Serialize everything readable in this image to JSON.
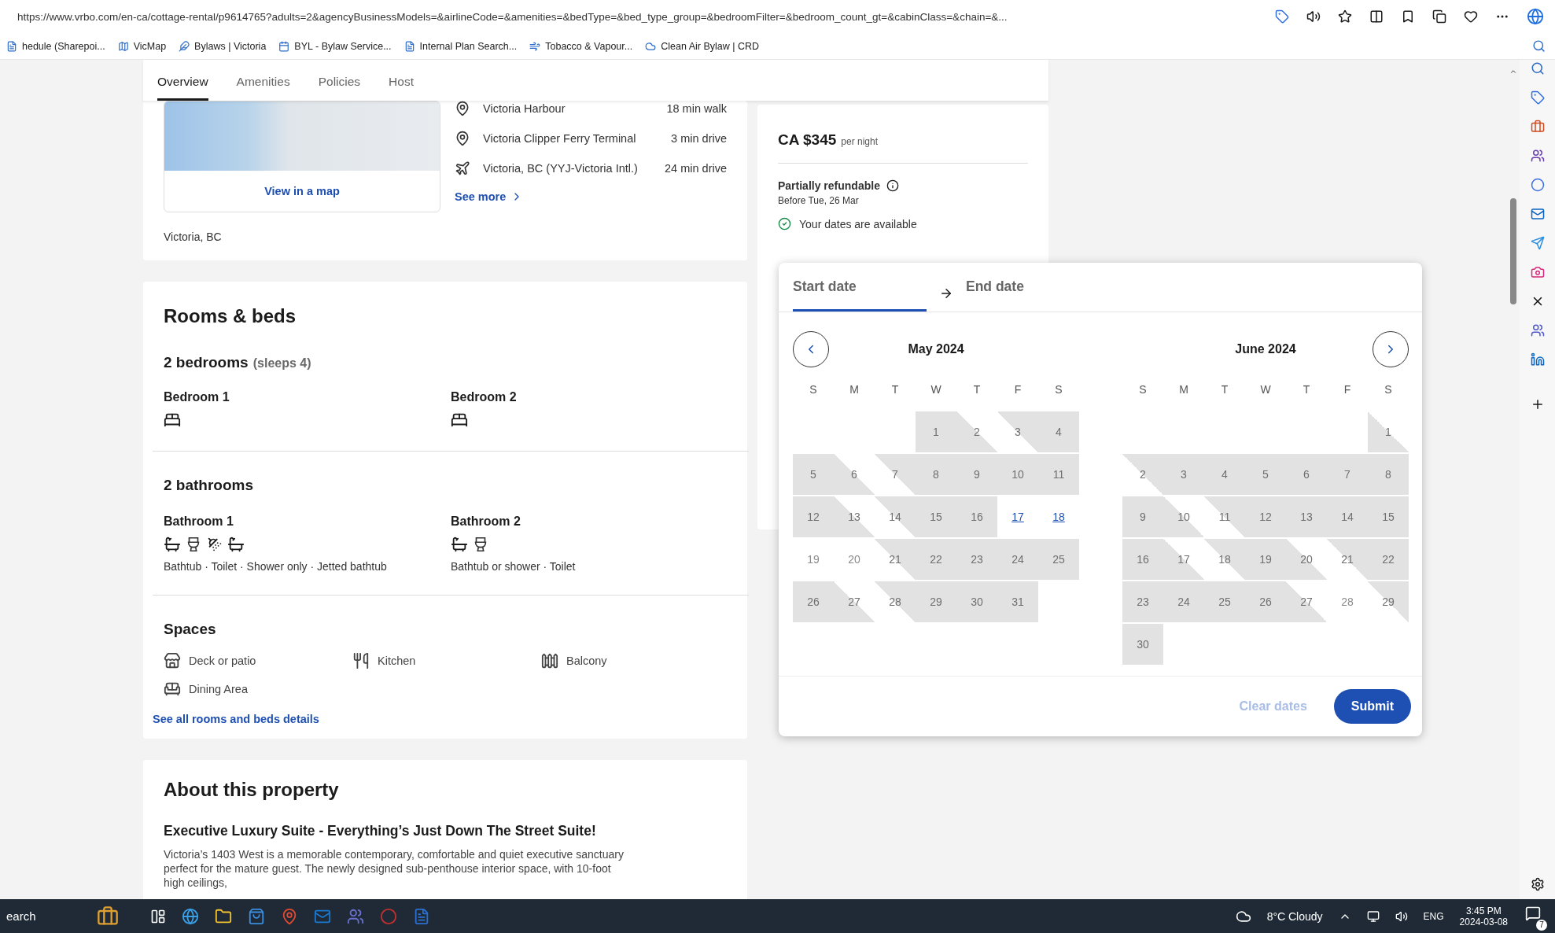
{
  "browser": {
    "url": "https://www.vrbo.com/en-ca/cottage-rental/p9614765?adults=2&agencyBusinessModels=&airlineCode=&amenities=&bedType=&bed_type_group=&bedroomFilter=&bedroom_count_gt=&cabinClass=&chain=&...",
    "bookmarks": [
      "hedule (Sharepoi...",
      "VicMap",
      "Bylaws | Victoria",
      "BYL - Bylaw Service...",
      "Internal Plan Search...",
      "Tobacco & Vapour...",
      "Clean Air Bylaw | CRD"
    ]
  },
  "tabs": [
    {
      "label": "Overview",
      "selected": true
    },
    {
      "label": "Amenities",
      "selected": false
    },
    {
      "label": "Policies",
      "selected": false
    },
    {
      "label": "Host",
      "selected": false
    }
  ],
  "location": {
    "map_link": "View in a map",
    "address": "Victoria, BC",
    "see_more": "See more",
    "places": [
      {
        "kind": "pin",
        "name": "Victoria Harbour",
        "distance": "18 min walk"
      },
      {
        "kind": "pin",
        "name": "Victoria Clipper Ferry Terminal",
        "distance": "3 min drive"
      },
      {
        "kind": "plane",
        "name": "Victoria, BC (YYJ-Victoria Intl.)",
        "distance": "24 min drive"
      }
    ]
  },
  "rooms": {
    "title": "Rooms & beds",
    "bedrooms": "2 bedrooms",
    "sleeps": "(sleeps 4)",
    "bedroom_list": [
      {
        "name": "Bedroom 1"
      },
      {
        "name": "Bedroom 2"
      }
    ],
    "bathrooms": "2 bathrooms",
    "bathroom_list": [
      {
        "name": "Bathroom 1",
        "fixtures": [
          {
            "kind": "bathtub"
          },
          {
            "kind": "toilet"
          },
          {
            "kind": "shower"
          },
          {
            "kind": "bathtub"
          }
        ],
        "summary": "Bathtub · Toilet · Shower only · Jetted bathtub"
      },
      {
        "name": "Bathroom 2",
        "fixtures": [
          {
            "kind": "bathtub"
          },
          {
            "kind": "toilet"
          }
        ],
        "summary": "Bathtub or shower · Toilet"
      }
    ],
    "spaces_title": "Spaces",
    "spaces": [
      {
        "kind": "deck",
        "label": "Deck or patio"
      },
      {
        "kind": "kitchen",
        "label": "Kitchen"
      },
      {
        "kind": "balcony",
        "label": "Balcony"
      },
      {
        "kind": "dining",
        "label": "Dining Area"
      }
    ],
    "details_link": "See all rooms and beds details"
  },
  "about": {
    "title": "About this property",
    "subtitle": "Executive Luxury Suite - Everything’s Just Down The Street Suite!",
    "description": "Victoria’s 1403 West is a memorable contemporary, comfortable and quiet executive sanctuary perfect for the mature guest. The newly designed sub-penthouse interior space, with 10-foot high ceilings,"
  },
  "booking": {
    "price": "CA $345",
    "per": "per night",
    "refund": "Partially refundable",
    "refund_date": "Before Tue, 26 Mar",
    "available": "Your dates are available"
  },
  "calendar": {
    "fields": [
      {
        "label": "Start date",
        "selected": true
      },
      {
        "label": "End date",
        "selected": false
      }
    ],
    "months": [
      {
        "title": "May 2024",
        "weekdays": [
          "S",
          "M",
          "T",
          "W",
          "T",
          "F",
          "S"
        ],
        "weeks": [
          [
            {
              "kind": "blank"
            },
            {
              "kind": "blank"
            },
            {
              "kind": "blank"
            },
            {
              "day": "1",
              "kind": "blocked"
            },
            {
              "day": "2",
              "kind": "checkout"
            },
            {
              "day": "3",
              "kind": "checkin"
            },
            {
              "day": "4",
              "kind": "blocked"
            }
          ],
          [
            {
              "day": "5",
              "kind": "blocked"
            },
            {
              "day": "6",
              "kind": "checkout"
            },
            {
              "day": "7",
              "kind": "checkin"
            },
            {
              "day": "8",
              "kind": "blocked"
            },
            {
              "day": "9",
              "kind": "blocked"
            },
            {
              "day": "10",
              "kind": "blocked"
            },
            {
              "day": "11",
              "kind": "blocked"
            }
          ],
          [
            {
              "day": "12",
              "kind": "blocked"
            },
            {
              "day": "13",
              "kind": "checkout"
            },
            {
              "day": "14",
              "kind": "checkin"
            },
            {
              "day": "15",
              "kind": "blocked"
            },
            {
              "day": "16",
              "kind": "blocked"
            },
            {
              "day": "17",
              "kind": "selectable"
            },
            {
              "day": "18",
              "kind": "selectable"
            }
          ],
          [
            {
              "day": "19",
              "kind": "open"
            },
            {
              "day": "20",
              "kind": "open"
            },
            {
              "day": "21",
              "kind": "checkin"
            },
            {
              "day": "22",
              "kind": "blocked"
            },
            {
              "day": "23",
              "kind": "blocked"
            },
            {
              "day": "24",
              "kind": "blocked"
            },
            {
              "day": "25",
              "kind": "blocked"
            }
          ],
          [
            {
              "day": "26",
              "kind": "blocked"
            },
            {
              "day": "27",
              "kind": "checkout"
            },
            {
              "day": "28",
              "kind": "checkin"
            },
            {
              "day": "29",
              "kind": "blocked"
            },
            {
              "day": "30",
              "kind": "blocked"
            },
            {
              "day": "31",
              "kind": "blocked"
            },
            {
              "kind": "blank"
            }
          ]
        ]
      },
      {
        "title": "June 2024",
        "weekdays": [
          "S",
          "M",
          "T",
          "W",
          "T",
          "F",
          "S"
        ],
        "weeks": [
          [
            {
              "kind": "blank"
            },
            {
              "kind": "blank"
            },
            {
              "kind": "blank"
            },
            {
              "kind": "blank"
            },
            {
              "kind": "blank"
            },
            {
              "kind": "blank"
            },
            {
              "day": "1",
              "kind": "checkout"
            }
          ],
          [
            {
              "day": "2",
              "kind": "checkin"
            },
            {
              "day": "3",
              "kind": "blocked"
            },
            {
              "day": "4",
              "kind": "blocked"
            },
            {
              "day": "5",
              "kind": "blocked"
            },
            {
              "day": "6",
              "kind": "blocked"
            },
            {
              "day": "7",
              "kind": "blocked"
            },
            {
              "day": "8",
              "kind": "blocked"
            }
          ],
          [
            {
              "day": "9",
              "kind": "blocked"
            },
            {
              "day": "10",
              "kind": "checkout"
            },
            {
              "day": "11",
              "kind": "checkin"
            },
            {
              "day": "12",
              "kind": "blocked"
            },
            {
              "day": "13",
              "kind": "blocked"
            },
            {
              "day": "14",
              "kind": "blocked"
            },
            {
              "day": "15",
              "kind": "blocked"
            }
          ],
          [
            {
              "day": "16",
              "kind": "blocked"
            },
            {
              "day": "17",
              "kind": "checkout"
            },
            {
              "day": "18",
              "kind": "checkin"
            },
            {
              "day": "19",
              "kind": "blocked"
            },
            {
              "day": "20",
              "kind": "checkout"
            },
            {
              "day": "21",
              "kind": "checkin"
            },
            {
              "day": "22",
              "kind": "blocked"
            }
          ],
          [
            {
              "day": "23",
              "kind": "blocked"
            },
            {
              "day": "24",
              "kind": "blocked"
            },
            {
              "day": "25",
              "kind": "blocked"
            },
            {
              "day": "26",
              "kind": "blocked"
            },
            {
              "day": "27",
              "kind": "checkout"
            },
            {
              "day": "28",
              "kind": "open"
            },
            {
              "day": "29",
              "kind": "checkin"
            }
          ],
          [
            {
              "day": "30",
              "kind": "blocked"
            }
          ]
        ]
      }
    ],
    "clear": "Clear dates",
    "clear_disabled": true,
    "submit": "Submit"
  },
  "taskbar": {
    "search": "earch",
    "weather": "8°C Cloudy",
    "lang": "ENG",
    "time": "3:45 PM",
    "date": "2024-03-08",
    "notifications": "7"
  }
}
